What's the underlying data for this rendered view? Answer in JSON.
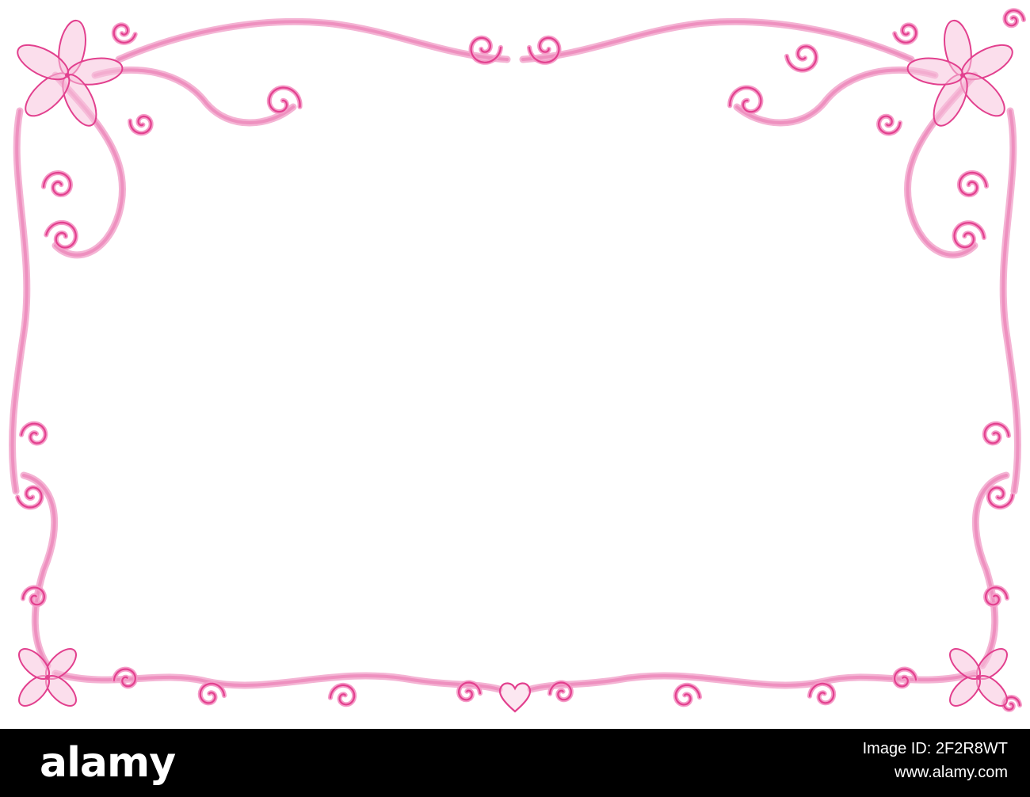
{
  "colors": {
    "background": "#ffffff",
    "ribbon_light": "#f4b4d4",
    "ribbon_mid": "#ee90bf",
    "curl_dark": "#e2408e",
    "curl_light": "#f59cc8",
    "petal_light": "#f7c3dd",
    "footer_bg": "#000000",
    "footer_text": "#ffffff"
  },
  "decor": {
    "type": "ornamental-pink-swirl-frame",
    "motifs": [
      "flower-icon",
      "swirl-icon",
      "heart-icon"
    ]
  },
  "footer": {
    "logo": "alamy",
    "image_id": "Image ID: 2F2R8WT",
    "url": "www.alamy.com"
  }
}
